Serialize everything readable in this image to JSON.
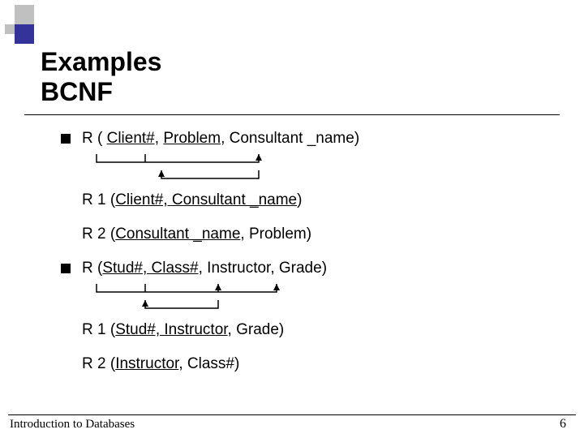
{
  "title_line1": "Examples",
  "title_line2": "BCNF",
  "item1": {
    "r_prefix": "R ( ",
    "r_u1": "Client#,",
    "r_mid1": " ",
    "r_u2": "Problem",
    "r_mid2": ", Consultant _name)",
    "r1_prefix": "R 1 (",
    "r1_u": "Client#, Consultant _name",
    "r1_suffix": ")",
    "r2_prefix": "R 2 (",
    "r2_u": "Consultant _name",
    "r2_suffix": ", Problem)"
  },
  "item2": {
    "r_prefix": "R (",
    "r_u": "Stud#, Class#,",
    "r_mid": " Instructor, Grade)",
    "r1_prefix": "R 1 (",
    "r1_u": "Stud#, Instructor",
    "r1_suffix": ", Grade)",
    "r2_prefix": "R 2 (",
    "r2_u": "Instructor",
    "r2_suffix": ", Class#)"
  },
  "footer_left": "Introduction to Databases",
  "footer_right": "6",
  "swatches": {
    "gray": "#c0c0c0",
    "purple": "#333399"
  }
}
